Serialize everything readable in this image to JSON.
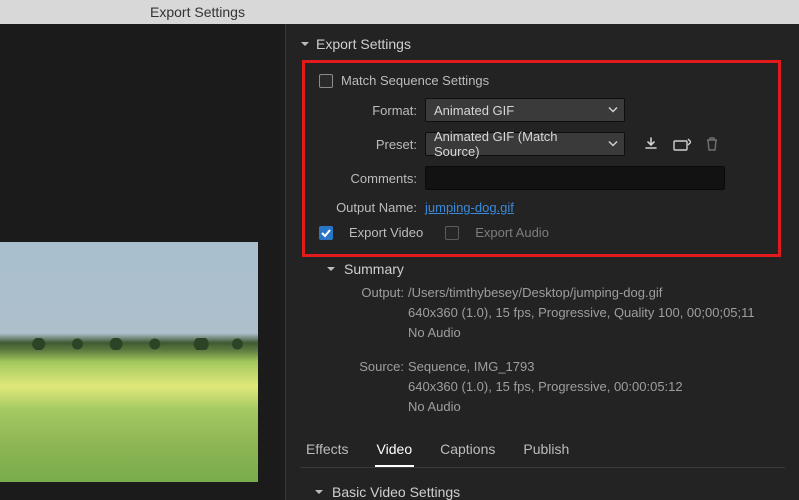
{
  "titlebar": {
    "title": "Export Settings"
  },
  "section": {
    "export_settings": "Export Settings"
  },
  "es": {
    "match_sequence_label": "Match Sequence Settings",
    "match_sequence_checked": false,
    "format_label": "Format:",
    "format_value": "Animated GIF",
    "preset_label": "Preset:",
    "preset_value": "Animated GIF (Match Source)",
    "comments_label": "Comments:",
    "comments_value": "",
    "output_name_label": "Output Name:",
    "output_name_value": "jumping-dog.gif",
    "export_video_label": "Export Video",
    "export_video_checked": true,
    "export_audio_label": "Export Audio",
    "export_audio_checked": false
  },
  "summary": {
    "heading": "Summary",
    "output_label": "Output:",
    "output_text": "/Users/timthybesey/Desktop/jumping-dog.gif\n640x360 (1.0), 15 fps, Progressive, Quality 100, 00;00;05;11\nNo Audio",
    "source_label": "Source:",
    "source_text": "Sequence, IMG_1793\n640x360 (1.0), 15 fps, Progressive, 00:00:05:12\nNo Audio"
  },
  "tabs": {
    "effects": "Effects",
    "video": "Video",
    "captions": "Captions",
    "publish": "Publish"
  },
  "bvs": {
    "heading": "Basic Video Settings"
  }
}
